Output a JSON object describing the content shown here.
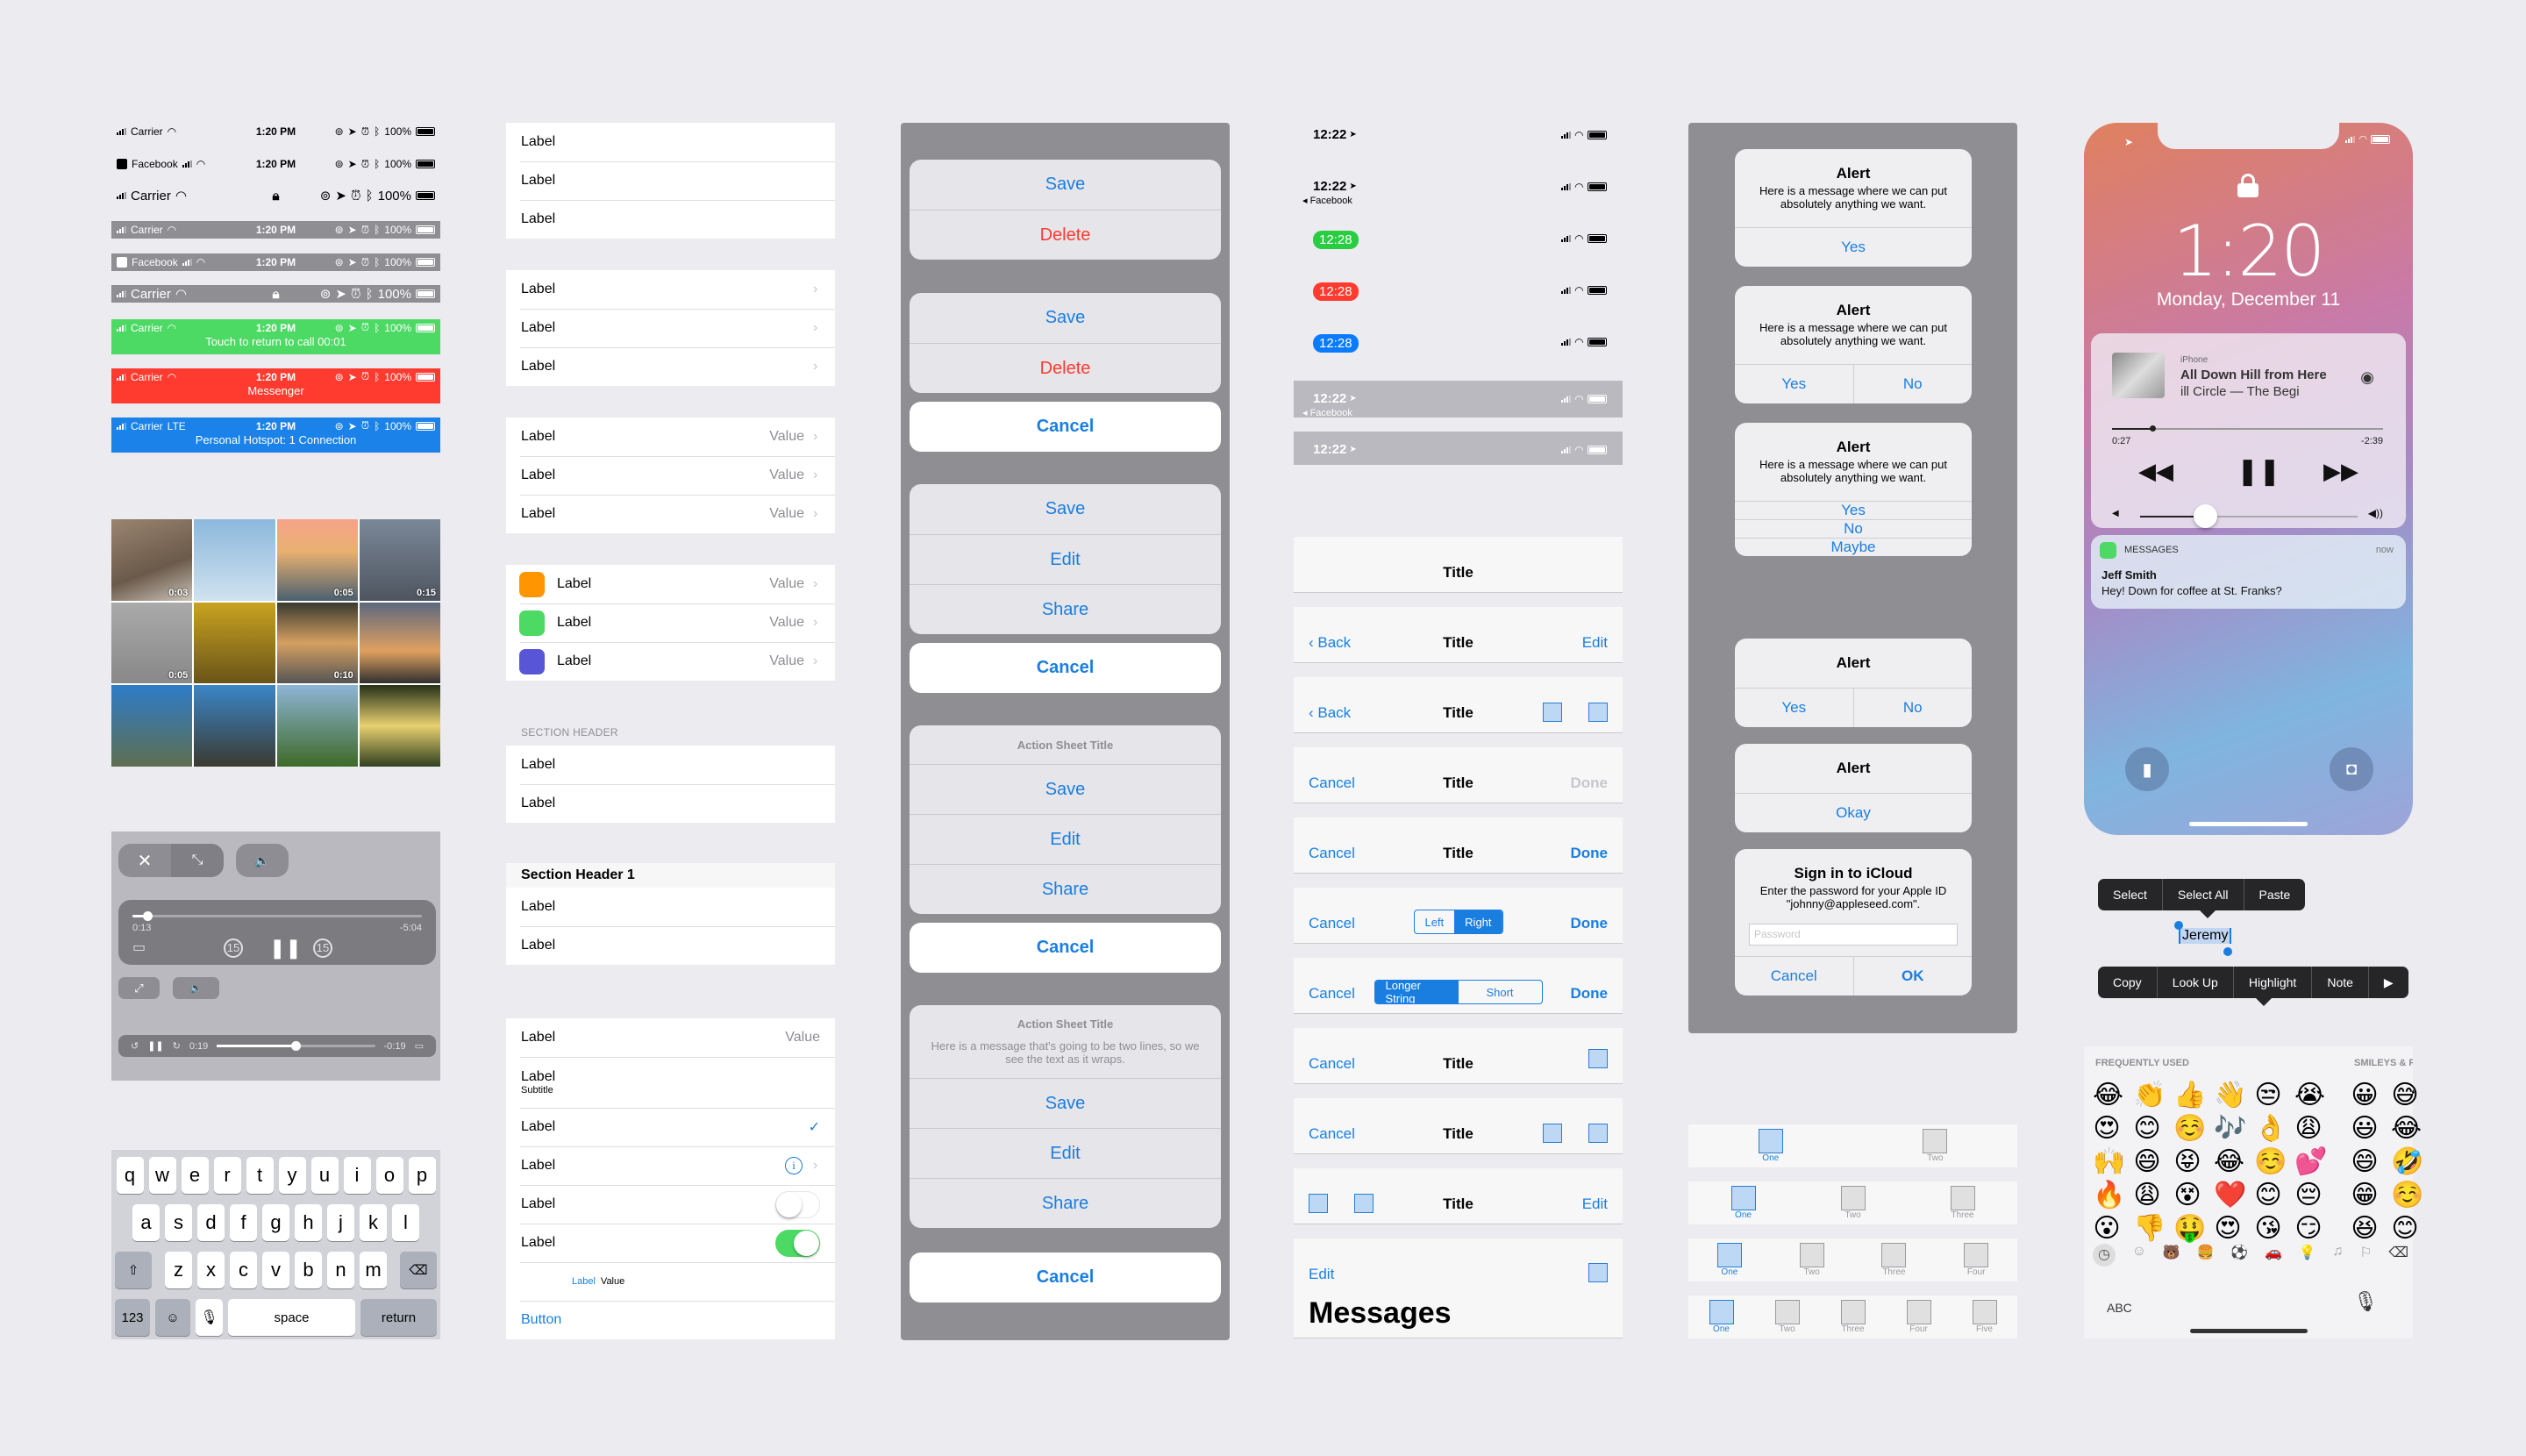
{
  "colors": {
    "accent": "#1a7ee0",
    "destructive": "#ff3b30",
    "green": "#4cd964",
    "overlay": "#8e8e93",
    "background": "#ebebf0"
  },
  "status_bars": [
    {
      "style": "dark",
      "left": "Carrier",
      "time": "1:20 PM",
      "battery": "100%"
    },
    {
      "style": "dark",
      "left": "Facebook",
      "time": "1:20 PM",
      "battery": "100%",
      "back_app": true
    },
    {
      "style": "dark-large",
      "left": "Carrier",
      "time": "",
      "battery": "100%",
      "center_icon": "lock-icon"
    },
    {
      "style": "gray",
      "left": "Carrier",
      "time": "1:20 PM",
      "battery": "100%"
    },
    {
      "style": "gray",
      "left": "Facebook",
      "time": "1:20 PM",
      "battery": "100%",
      "back_app": true
    },
    {
      "style": "gray-large",
      "left": "Carrier",
      "time": "",
      "battery": "100%",
      "center_icon": "lock-icon"
    },
    {
      "style": "green",
      "left": "Carrier",
      "time": "1:20 PM",
      "battery": "100%",
      "message": "Touch to return to call 00:01"
    },
    {
      "style": "red",
      "left": "Carrier",
      "time": "1:20 PM",
      "battery": "100%",
      "message": "Messenger"
    },
    {
      "style": "blue",
      "left": "Carrier",
      "network": "LTE",
      "time": "1:20 PM",
      "battery": "100%",
      "message": "Personal Hotspot: 1 Connection"
    }
  ],
  "photo_grid": {
    "durations": [
      "0:03",
      "",
      "0:05",
      "0:15",
      "0:05",
      "",
      "0:10",
      "",
      "",
      "",
      "",
      ""
    ]
  },
  "video_player": {
    "elapsed": "0:13",
    "remaining": "-5:04",
    "skip_seconds": "15",
    "progress": 0.05,
    "mini_elapsed": "0:19",
    "mini_remaining": "-0:19",
    "mini_progress": 0.5
  },
  "keyboard": {
    "row1": [
      "q",
      "w",
      "e",
      "r",
      "t",
      "y",
      "u",
      "i",
      "o",
      "p"
    ],
    "row2": [
      "a",
      "s",
      "d",
      "f",
      "g",
      "h",
      "j",
      "k",
      "l"
    ],
    "row3": [
      "z",
      "x",
      "c",
      "v",
      "b",
      "n",
      "m"
    ],
    "numbers": "123",
    "space": "space",
    "return": "return"
  },
  "tables": {
    "plain": [
      "Label",
      "Label",
      "Label"
    ],
    "disclosure": [
      "Label",
      "Label",
      "Label"
    ],
    "value_rows": [
      {
        "label": "Label",
        "value": "Value"
      },
      {
        "label": "Label",
        "value": "Value"
      },
      {
        "label": "Label",
        "value": "Value"
      }
    ],
    "icon_rows": [
      {
        "label": "Label",
        "value": "Value",
        "color": "#ff9500"
      },
      {
        "label": "Label",
        "value": "Value",
        "color": "#4cd964"
      },
      {
        "label": "Label",
        "value": "Value",
        "color": "#5856d6"
      }
    ],
    "section_header": "SECTION HEADER",
    "section_rows": [
      "Label",
      "Label"
    ],
    "section_header_1": "Section Header 1",
    "section1_rows": [
      "Label",
      "Label"
    ],
    "mixed": {
      "r1_label": "Label",
      "r1_value": "Value",
      "r2_label": "Label",
      "r2_subtitle": "Subtitle",
      "r3_label": "Label",
      "r4_label": "Label",
      "r5_label": "Label",
      "r5_toggle": false,
      "r6_label": "Label",
      "r6_toggle": true,
      "r7_label": "Label",
      "r7_value": "Value",
      "button": "Button"
    }
  },
  "action_sheets": {
    "sheet1": [
      "Save",
      "Delete"
    ],
    "sheet2": [
      "Save",
      "Delete"
    ],
    "sheet3": [
      "Save",
      "Edit",
      "Share"
    ],
    "sheet4_title": "Action Sheet Title",
    "sheet4": [
      "Save",
      "Edit",
      "Share"
    ],
    "sheet5_title": "Action Sheet Title",
    "sheet5_message": "Here is a message that's going to be two lines, so we see the text as it wraps.",
    "sheet5": [
      "Save",
      "Edit",
      "Share"
    ],
    "cancel": "Cancel"
  },
  "x_status_bars": [
    {
      "time": "12:22"
    },
    {
      "time": "12:22",
      "back": "◂ Facebook"
    },
    {
      "time": "12:28",
      "pill": "#28cd41"
    },
    {
      "time": "12:28",
      "pill": "#ff3b30"
    },
    {
      "time": "12:28",
      "pill": "#0a7aff"
    },
    {
      "time": "12:22",
      "back": "◂ Facebook",
      "gray": true
    },
    {
      "time": "12:22",
      "gray": true
    }
  ],
  "nav_bars": {
    "title": "Title",
    "back": "Back",
    "edit": "Edit",
    "cancel": "Cancel",
    "done": "Done",
    "seg1": [
      "Left",
      "Right"
    ],
    "seg2": [
      "Longer String",
      "Short"
    ],
    "large_title": "Messages"
  },
  "alerts": {
    "title": "Alert",
    "message": "Here is a message where we can put absolutely anything we want.",
    "yes": "Yes",
    "no": "No",
    "maybe": "Maybe",
    "okay": "Okay",
    "signin_title": "Sign in to iCloud",
    "signin_message": "Enter the password for your Apple ID \"johnny@appleseed.com\".",
    "password_placeholder": "Password",
    "cancel": "Cancel",
    "ok": "OK"
  },
  "tab_bars": [
    [
      "One",
      "Two"
    ],
    [
      "One",
      "Two",
      "Three"
    ],
    [
      "One",
      "Two",
      "Three",
      "Four"
    ],
    [
      "One",
      "Two",
      "Three",
      "Four",
      "Five"
    ]
  ],
  "lock_screen": {
    "time": "1:20",
    "date": "Monday, December 11",
    "now_playing": {
      "source": "iPhone",
      "title": "All Down Hill from Here",
      "subtitle": "ill Circle — The Begi",
      "elapsed": "0:27",
      "remaining": "-2:39",
      "progress": 0.15,
      "volume": 0.3
    },
    "notification": {
      "app": "MESSAGES",
      "time": "now",
      "sender": "Jeff Smith",
      "body": "Hey! Down for coffee at St. Franks?"
    }
  },
  "edit_menu": {
    "top": [
      "Select",
      "Select All",
      "Paste"
    ],
    "selected_text": "Jeremy",
    "bottom": [
      "Copy",
      "Look Up",
      "Highlight",
      "Note"
    ]
  },
  "emoji_keyboard": {
    "section1": "FREQUENTLY USED",
    "section2": "SMILEYS & P",
    "rows": [
      [
        "😂",
        "👏",
        "👍",
        "👋",
        "😒",
        "😭",
        "😀",
        "😅"
      ],
      [
        "😍",
        "😊",
        "☺️",
        "🎶",
        "👌",
        "😩",
        "😃",
        "😂"
      ],
      [
        "🙌",
        "😄",
        "😝",
        "😂",
        "☺️",
        "💕",
        "😄",
        "🤣"
      ],
      [
        "🔥",
        "😩",
        "😵",
        "❤️",
        "😊",
        "😔",
        "😁",
        "☺️"
      ],
      [
        "😮",
        "👎",
        "🤑",
        "😍",
        "😘",
        "😏",
        "😆",
        "😊"
      ]
    ],
    "abc": "ABC"
  }
}
